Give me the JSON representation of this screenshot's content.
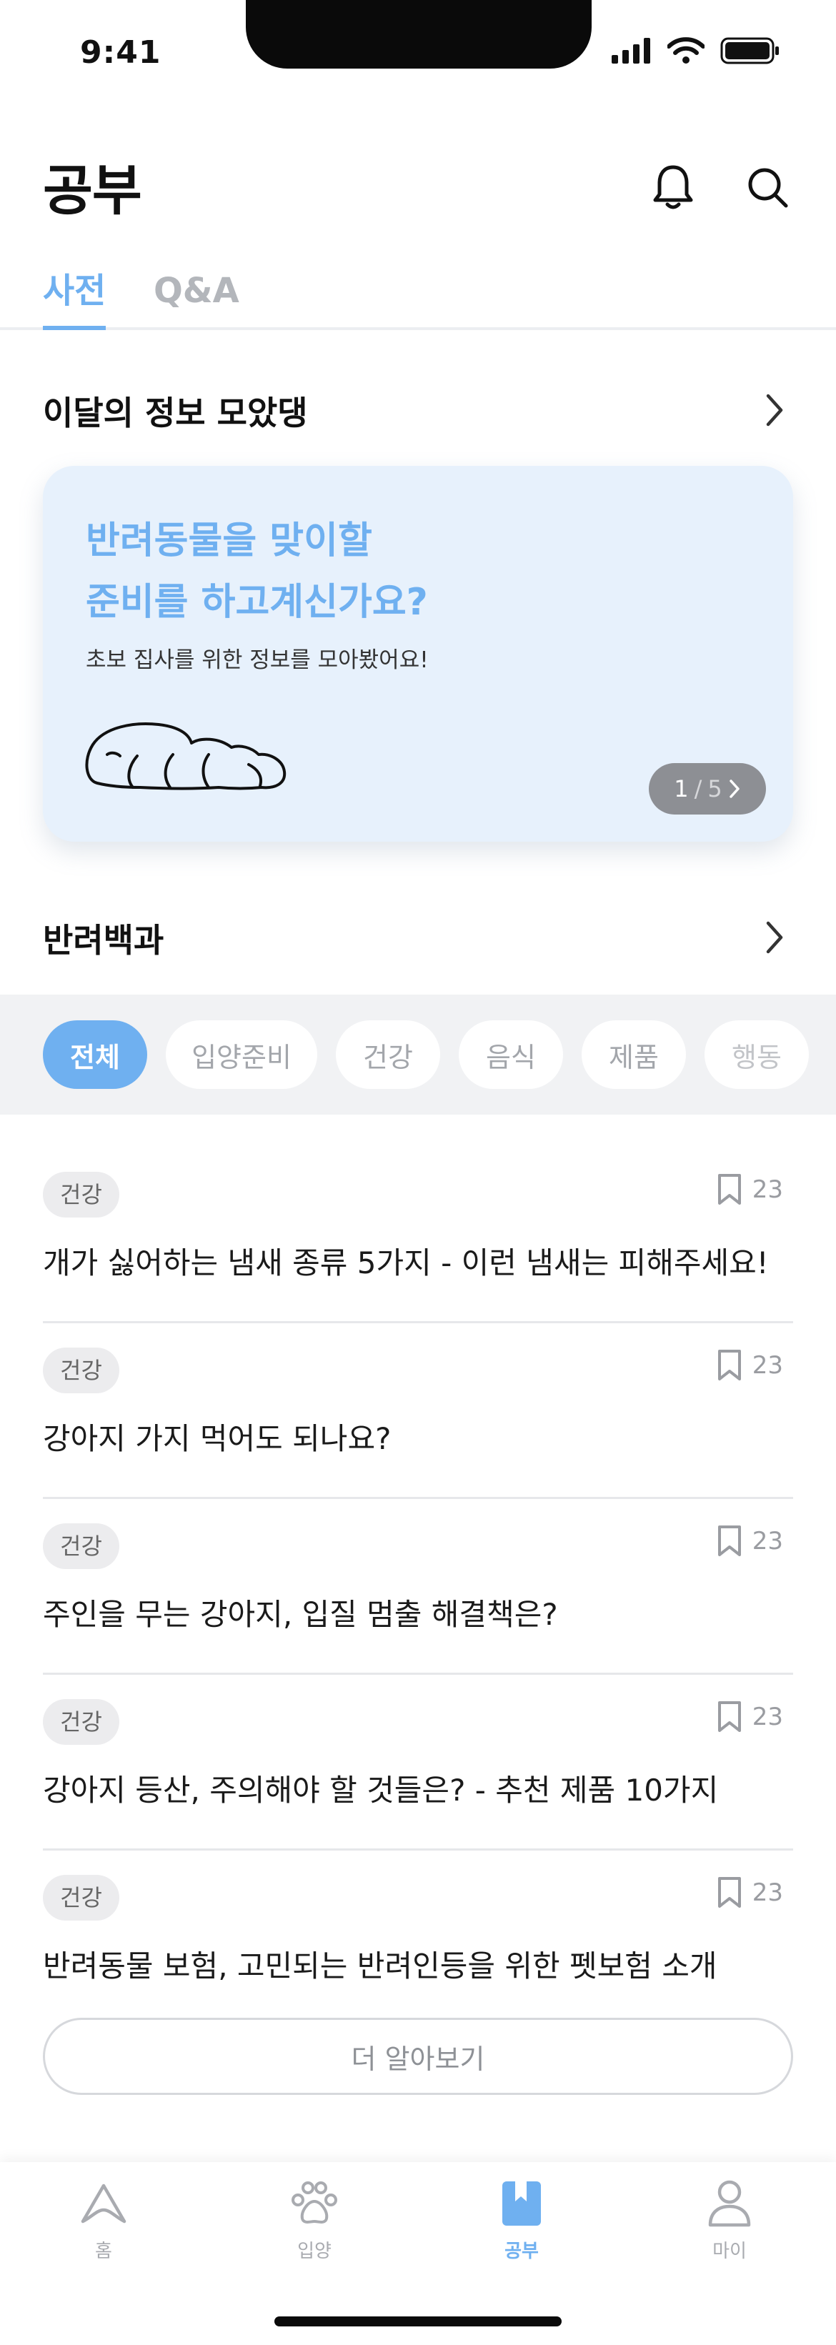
{
  "status": {
    "time": "9:41"
  },
  "header": {
    "title": "공부",
    "bell_icon": "bell-icon",
    "search_icon": "search-icon"
  },
  "tabs": [
    {
      "label": "사전",
      "active": true
    },
    {
      "label": "Q&A",
      "active": false
    }
  ],
  "monthly": {
    "title": "이달의 정보 모았댕",
    "banner": {
      "line1": "반려동물을 맞이할",
      "line2": "준비를 하고계신가요?",
      "subtitle": "초보 집사를 위한 정보를 모아봤어요!",
      "page_current": "1",
      "page_sep": "/",
      "page_total": "5"
    }
  },
  "encyclopedia": {
    "title": "반려백과",
    "chips": [
      "전체",
      "입양준비",
      "건강",
      "음식",
      "제품",
      "행동"
    ],
    "active_chip": "전체",
    "articles": [
      {
        "badge": "건강",
        "count": "23",
        "title": "개가 싫어하는 냄새 종류 5가지 - 이런 냄새는 피해주세요!"
      },
      {
        "badge": "건강",
        "count": "23",
        "title": "강아지 가지 먹어도 되나요?"
      },
      {
        "badge": "건강",
        "count": "23",
        "title": "주인을 무는 강아지, 입질 멈출 해결책은?"
      },
      {
        "badge": "건강",
        "count": "23",
        "title": "강아지 등산, 주의해야 할 것들은? - 추천 제품 10가지"
      },
      {
        "badge": "건강",
        "count": "23",
        "title": "반려동물 보험, 고민되는 반려인등을 위한 펫보험 소개"
      }
    ],
    "more_label": "더 알아보기"
  },
  "nav": [
    {
      "label": "홈",
      "icon": "home-icon",
      "active": false
    },
    {
      "label": "입양",
      "icon": "paw-icon",
      "active": false
    },
    {
      "label": "공부",
      "icon": "book-icon",
      "active": true
    },
    {
      "label": "마이",
      "icon": "person-icon",
      "active": false
    }
  ],
  "colors": {
    "accent": "#6fb0f0",
    "banner_bg": "#e7f1fc",
    "chip_bar_bg": "#f1f2f4"
  }
}
